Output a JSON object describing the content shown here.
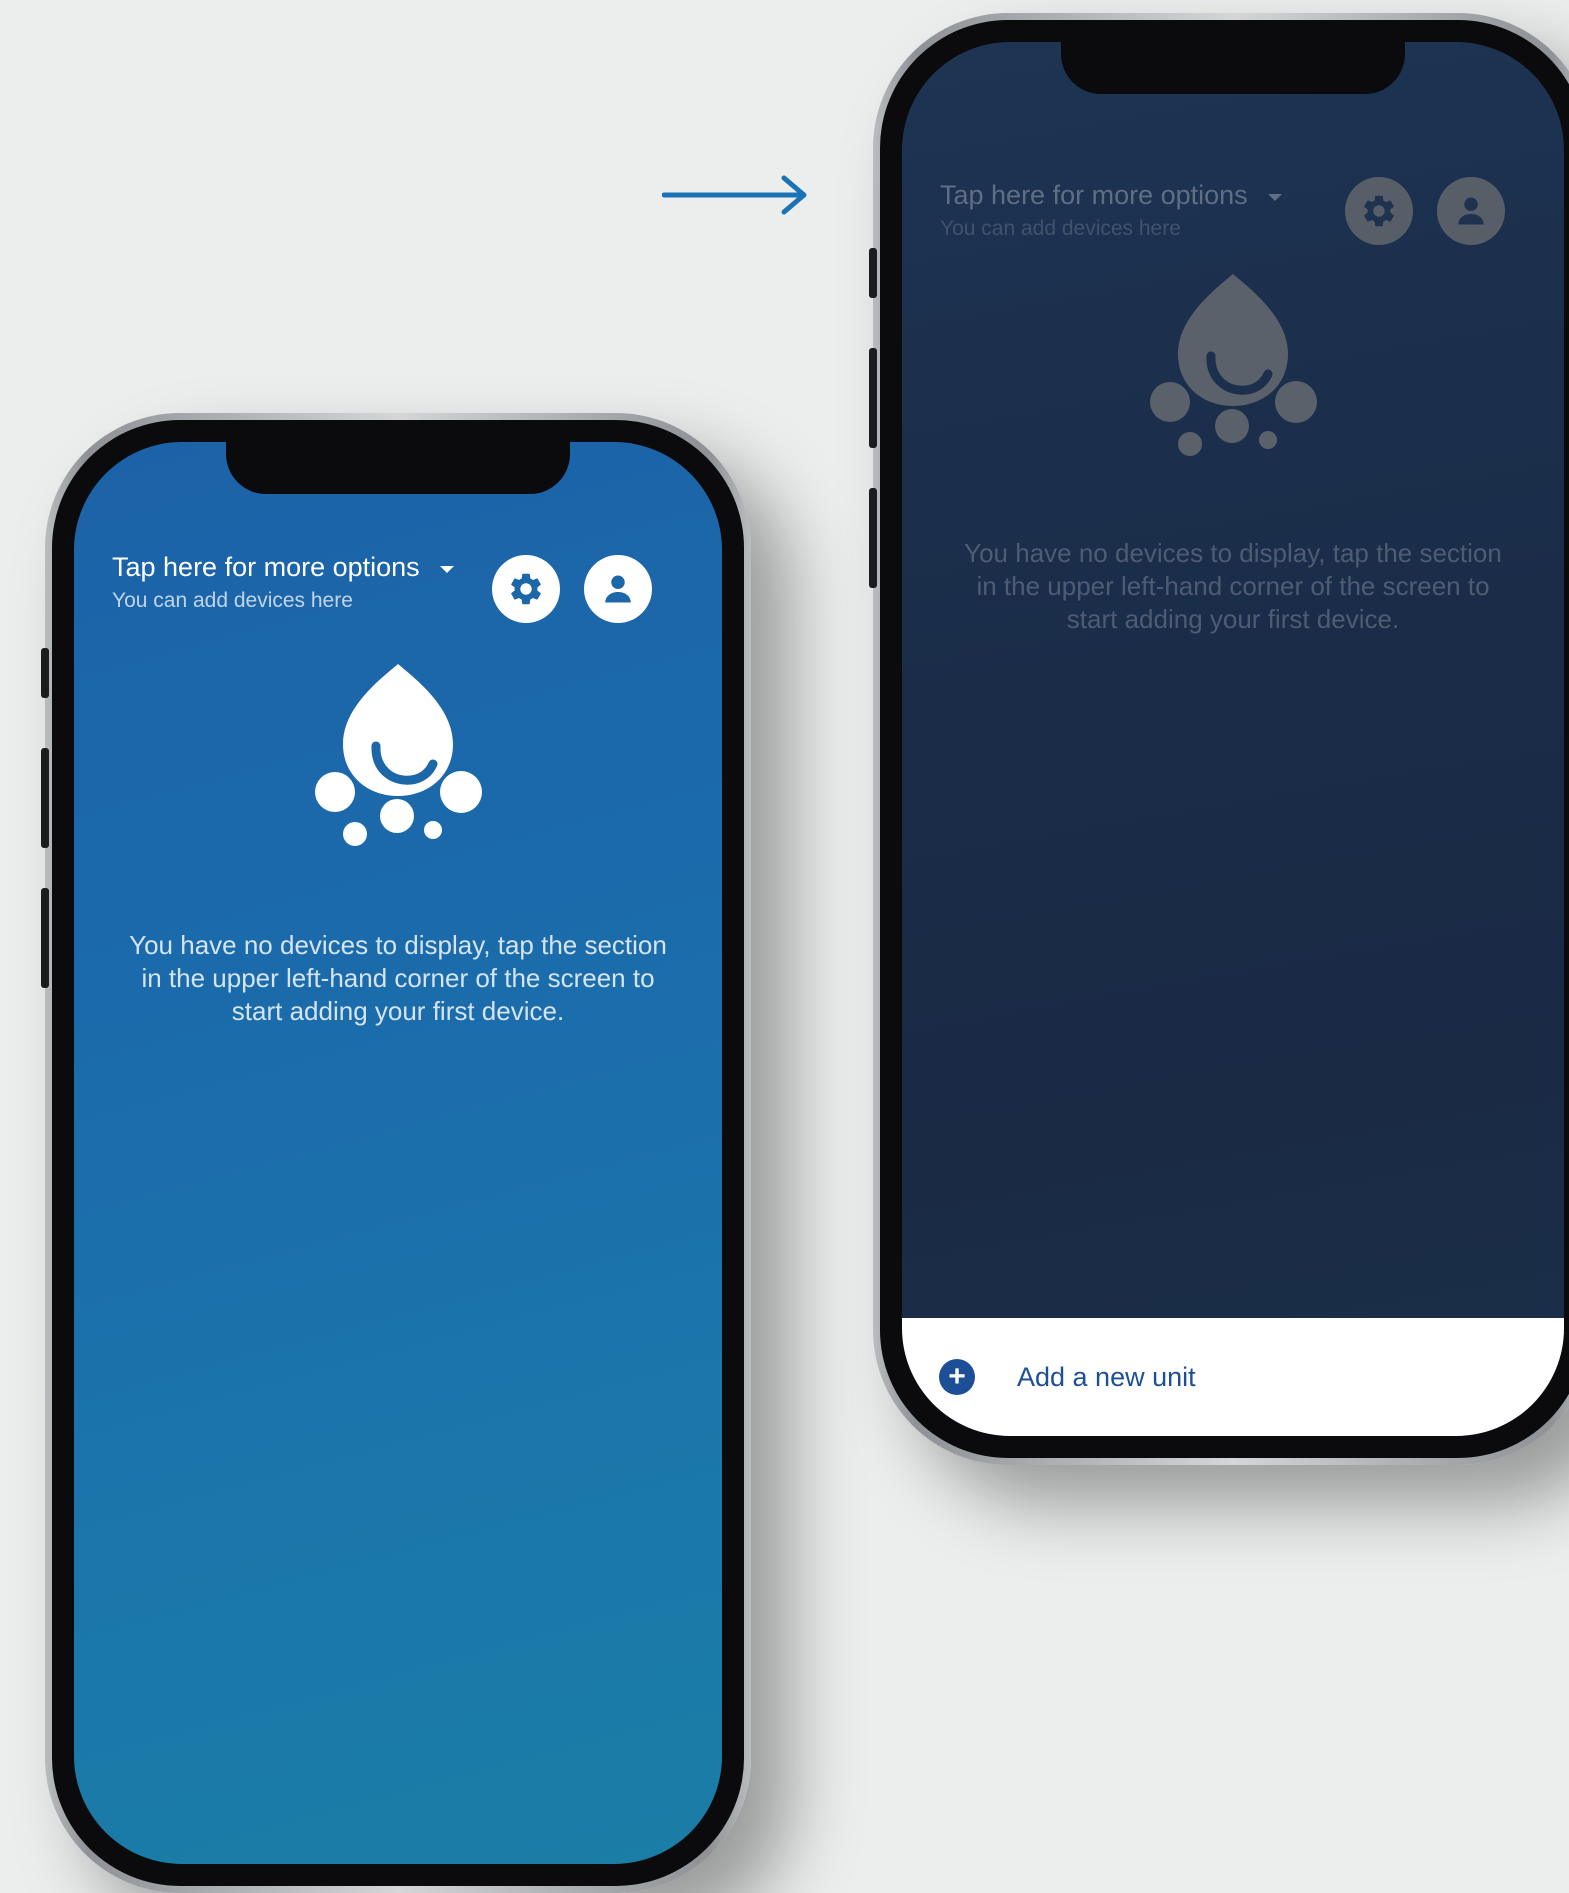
{
  "screen_empty": {
    "header": {
      "title": "Tap here for more options",
      "subtitle": "You can add devices here"
    },
    "icons": {
      "settings": "gear-icon",
      "profile": "user-icon",
      "logo": "water-drop-logo"
    },
    "empty_message": "You have no devices to display, tap the section in the upper left-hand corner of the screen to start adding your first device."
  },
  "screen_menu_open": {
    "header": {
      "title": "Tap here for more options",
      "subtitle": "You can add devices here"
    },
    "empty_message": "You have no devices to display, tap the section in the upper left-hand corner of the screen to start adding your first device.",
    "bottom_sheet": {
      "label": "Add a new unit",
      "icon": "plus-circle-icon"
    }
  },
  "transition_arrow": "right-arrow-icon",
  "colors": {
    "primary_blue": "#1b6aab",
    "dimmed_navy": "#1a2c48",
    "accent_dark_blue": "#1d4f97",
    "arrow_blue": "#1a73b6",
    "background": "#eceeee"
  }
}
